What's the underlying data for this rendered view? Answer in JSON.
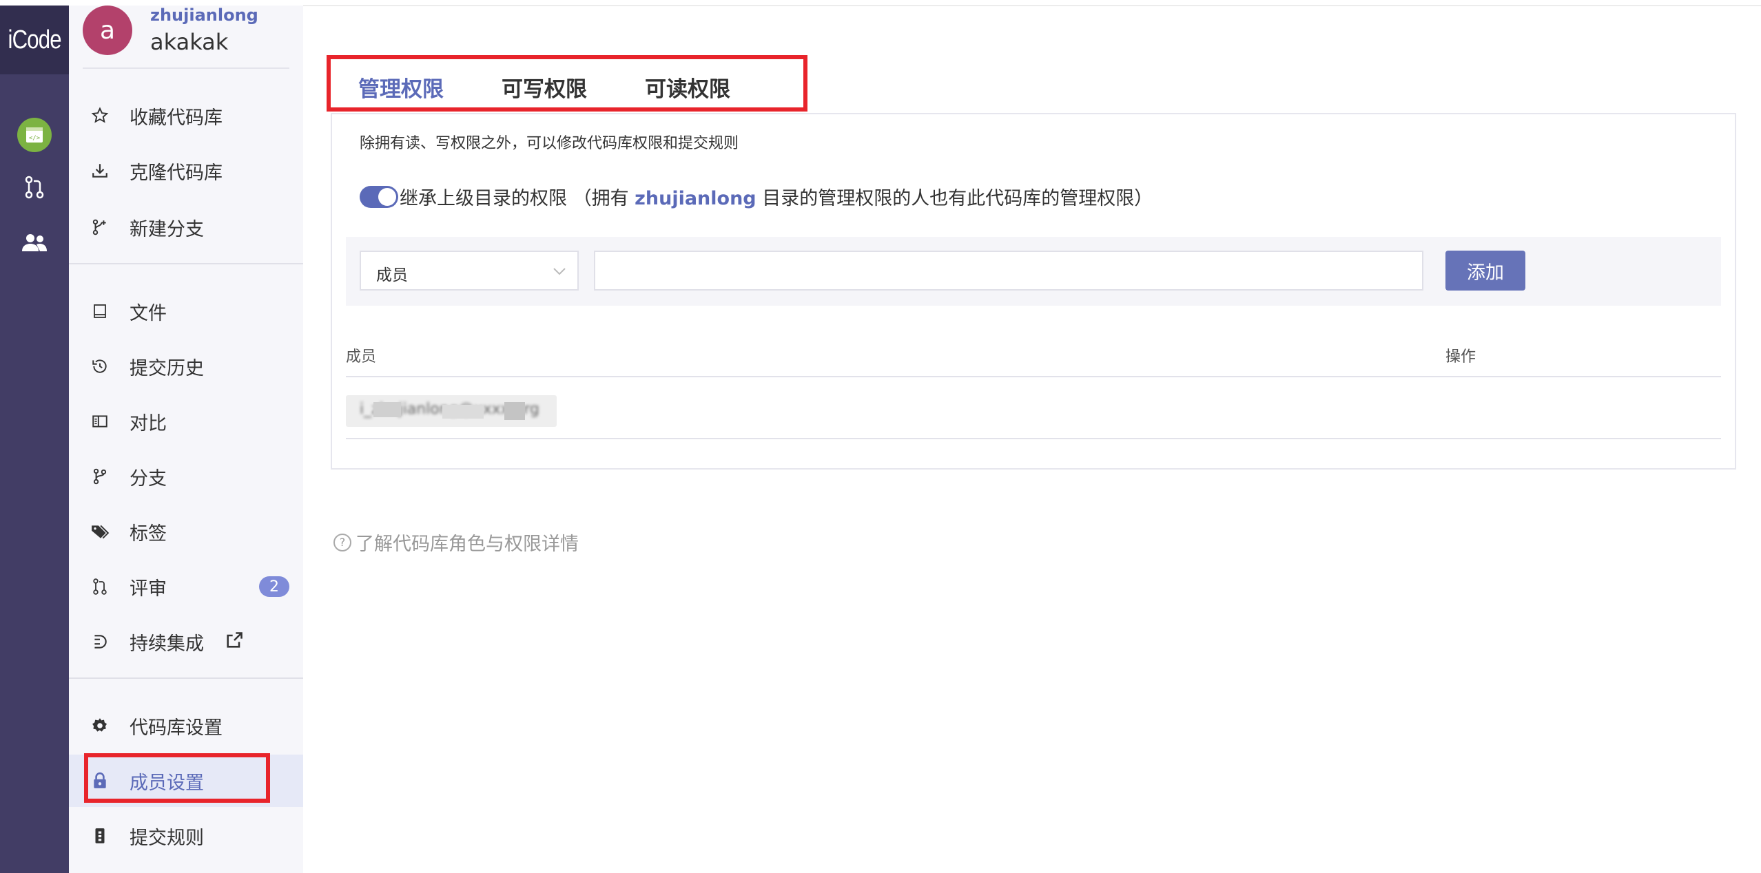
{
  "brand": "iCode",
  "user": {
    "avatar_letter": "a",
    "namespace": "zhujianlong",
    "repo": "akakak"
  },
  "sidebar": {
    "items": [
      {
        "label": "收藏代码库",
        "icon": "star-icon"
      },
      {
        "label": "克隆代码库",
        "icon": "download-icon"
      },
      {
        "label": "新建分支",
        "icon": "branch-plus-icon"
      },
      {
        "label": "文件",
        "icon": "book-icon"
      },
      {
        "label": "提交历史",
        "icon": "history-icon"
      },
      {
        "label": "对比",
        "icon": "compare-icon"
      },
      {
        "label": "分支",
        "icon": "branch-icon"
      },
      {
        "label": "标签",
        "icon": "tags-icon"
      },
      {
        "label": "评审",
        "icon": "pull-request-icon",
        "badge": "2"
      },
      {
        "label": "持续集成",
        "icon": "ci-icon"
      },
      {
        "label": "代码库设置",
        "icon": "gear-icon"
      },
      {
        "label": "成员设置",
        "icon": "lock-icon",
        "active": true
      },
      {
        "label": "提交规则",
        "icon": "rules-icon"
      }
    ]
  },
  "tabs": [
    {
      "label": "管理权限",
      "active": true
    },
    {
      "label": "可写权限"
    },
    {
      "label": "可读权限"
    }
  ],
  "panel": {
    "description": "除拥有读、写权限之外，可以修改代码库权限和提交规则",
    "inherit_prefix": "继承上级目录的权限 （拥有 ",
    "inherit_highlight": "zhujianlong",
    "inherit_suffix": " 目录的管理权限的人也有此代码库的管理权限）",
    "select_value": "成员",
    "add_button": "添加",
    "table_headers": [
      "成员",
      "操作"
    ],
    "rows": [
      {
        "member": "i_zhujianlong@xxxx.org"
      }
    ]
  },
  "help_link": "了解代码库角色与权限详情",
  "colors": {
    "accent": "#5b6ab8",
    "rail": "#423d65",
    "highlight_box": "#e8242b",
    "badge": "#7f8bd9"
  }
}
